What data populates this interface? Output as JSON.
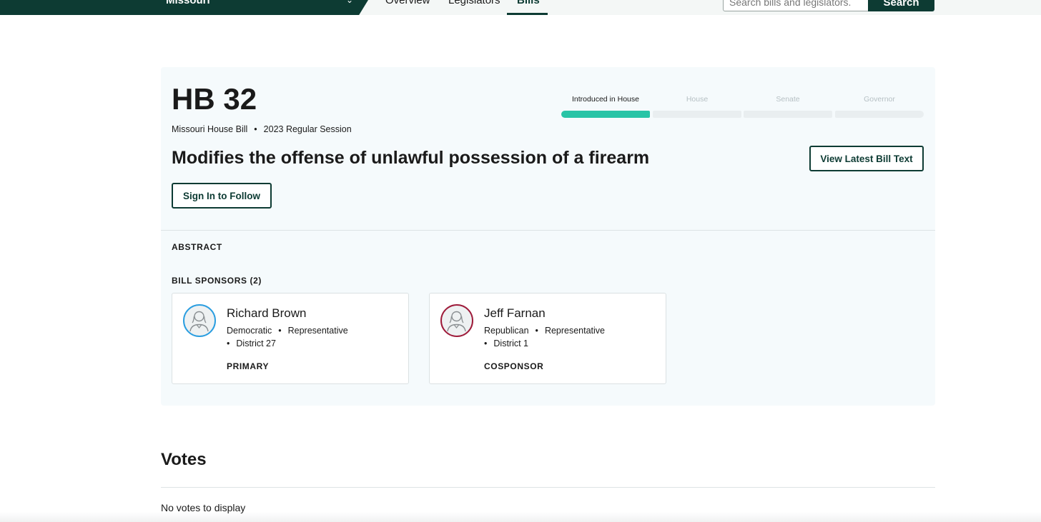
{
  "nav": {
    "state_name": "Missouri",
    "tabs": [
      {
        "label": "Overview",
        "active": false
      },
      {
        "label": "Legislators",
        "active": false
      },
      {
        "label": "Bills",
        "active": true
      }
    ],
    "search": {
      "placeholder": "Search bills and legislators.",
      "button_label": "Search"
    }
  },
  "bill": {
    "number": "HB 32",
    "chamber_type": "Missouri House Bill",
    "session": "2023 Regular Session",
    "title": "Modifies the offense of unlawful possession of a firearm",
    "follow_label": "Sign In to Follow",
    "view_text_label": "View Latest Bill Text",
    "progress": {
      "current_step": "Introduced in House",
      "steps": [
        "Introduced in House",
        "House",
        "Senate",
        "Governor"
      ],
      "completed": 1
    },
    "abstract_label": "ABSTRACT",
    "sponsors_label": "BILL SPONSORS (2)",
    "sponsors": [
      {
        "name": "Richard Brown",
        "party": "Democratic",
        "title": "Representative",
        "district": "District 27",
        "role": "PRIMARY"
      },
      {
        "name": "Jeff Farnan",
        "party": "Republican",
        "title": "Representative",
        "district": "District 1",
        "role": "COSPONSOR"
      }
    ]
  },
  "votes": {
    "heading": "Votes",
    "empty_message": "No votes to display"
  },
  "colors": {
    "brand_dark": "#0d3b33",
    "progress_fill": "#28c4a6",
    "democratic": "#2b9ee0",
    "republican": "#9e1b3a"
  },
  "icons": {
    "sponsor_avatar": "person-placeholder-icon",
    "state_dropdown": "chevron-down-icon",
    "separator": "bullet"
  }
}
